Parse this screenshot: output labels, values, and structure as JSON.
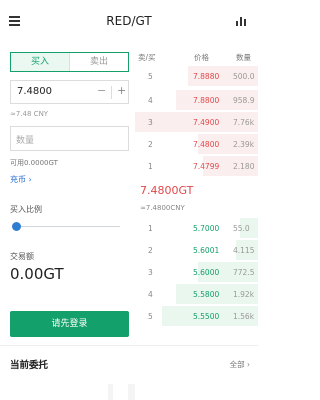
{
  "header": {
    "title": "RED/GT",
    "menu_icon": "menu-icon",
    "chart_icon": "bar-chart-icon"
  },
  "trade_form": {
    "tabs": [
      {
        "label": "买入",
        "active": true
      },
      {
        "label": "卖出",
        "active": false
      }
    ],
    "price_input": {
      "value": "7.4800",
      "minus": "−",
      "plus": "+"
    },
    "price_cny_estimate": "≈7.48 CNY",
    "quantity_input": {
      "placeholder": "数量"
    },
    "available": "可用0.0000GT",
    "recharge_link": "充币 ›",
    "ratio_label": "买入比例",
    "ratio_value": 0,
    "amount_label": "交易额",
    "amount_value": "0.00GT",
    "login_button": "请先登录"
  },
  "order_book": {
    "headers": {
      "side": "卖/买",
      "price": "价格",
      "quantity": "数量"
    },
    "asks": [
      {
        "index": "5",
        "price": "7.8880",
        "quantity": "500.0"
      },
      {
        "index": "4",
        "price": "7.8800",
        "quantity": "958.9"
      },
      {
        "index": "3",
        "price": "7.4900",
        "quantity": "7.76k"
      },
      {
        "index": "2",
        "price": "7.4800",
        "quantity": "2.39k"
      },
      {
        "index": "1",
        "price": "7.4799",
        "quantity": "2.180"
      }
    ],
    "last_price": "7.4800GT",
    "last_price_cny": "≈7.4800CNY",
    "bids": [
      {
        "index": "1",
        "price": "5.7000",
        "quantity": "55.0"
      },
      {
        "index": "2",
        "price": "5.6001",
        "quantity": "4.115"
      },
      {
        "index": "3",
        "price": "5.6000",
        "quantity": "772.5"
      },
      {
        "index": "4",
        "price": "5.5800",
        "quantity": "1.92k"
      },
      {
        "index": "5",
        "price": "5.5500",
        "quantity": "1.56k"
      }
    ]
  },
  "current_orders": {
    "title": "当前委托",
    "all_link": "全部 ›"
  },
  "colors": {
    "buy_green": "#14a06b",
    "sell_red": "#e0494b",
    "link_blue": "#2b6fd6",
    "slider_blue": "#2e7dd1"
  }
}
